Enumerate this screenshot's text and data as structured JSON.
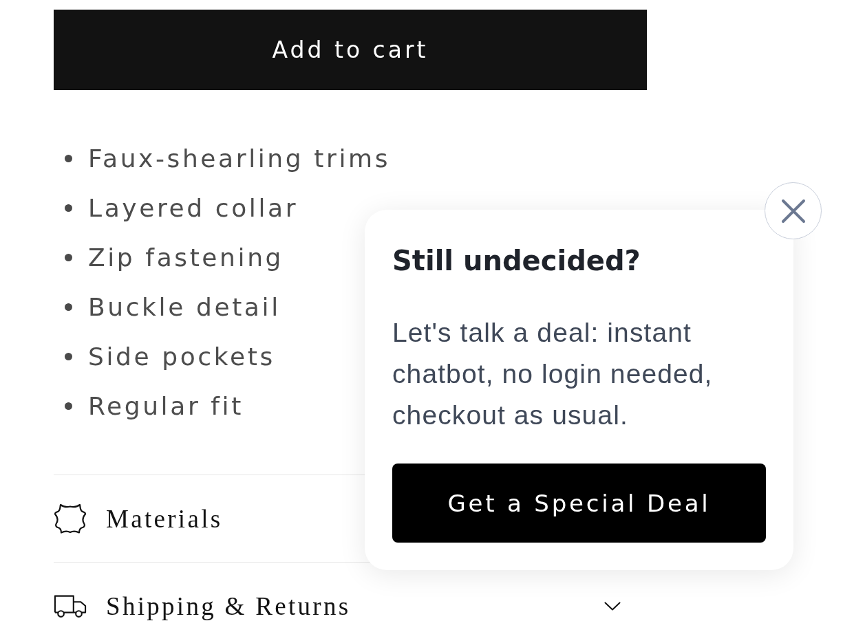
{
  "add_to_cart_button": {
    "label": "Add to cart"
  },
  "features": [
    "Faux-shearling trims",
    "Layered collar",
    "Zip fastening",
    "Buckle detail",
    "Side pockets",
    "Regular fit"
  ],
  "accordions": [
    {
      "kind": "materials",
      "title": "Materials"
    },
    {
      "kind": "shipping",
      "title": "Shipping & Returns",
      "expanded": false
    }
  ],
  "popup": {
    "title": "Still undecided?",
    "body": "Let's talk a deal: instant chatbot, no login needed, checkout as usual.",
    "button": "Get a Special Deal"
  }
}
